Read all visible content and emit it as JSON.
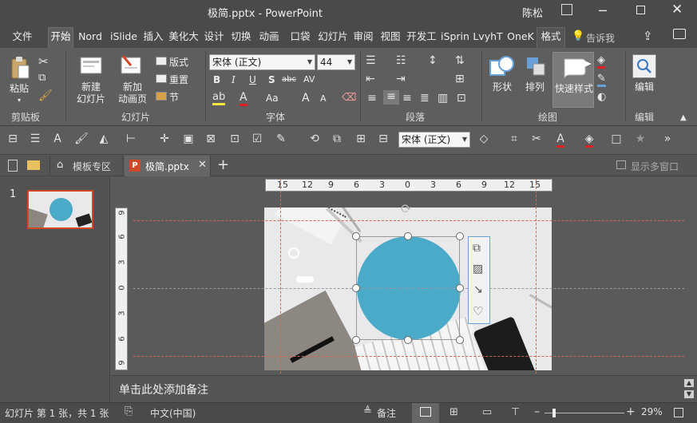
{
  "window": {
    "title": "极简.pptx  -  PowerPoint",
    "user": "陈松"
  },
  "tabs": [
    "文件",
    "开始",
    "Nord",
    "iSlide",
    "插入",
    "美化大",
    "设计",
    "切换",
    "动画",
    "口袋",
    "幻灯片",
    "审阅",
    "视图",
    "开发工",
    "iSprin",
    "LvyhT",
    "OneK",
    "格式"
  ],
  "tell_me": "告诉我",
  "ribbon": {
    "clipboard": {
      "label": "剪贴板",
      "paste": "粘贴"
    },
    "slides": {
      "label": "幻灯片",
      "new_slide_l1": "新建",
      "new_slide_l2": "幻灯片",
      "new_anim_l1": "新加",
      "new_anim_l2": "动画页",
      "layout": "版式",
      "reset": "重置",
      "section": "节"
    },
    "font": {
      "label": "字体",
      "font_name": "宋体 (正文)",
      "font_size": "44",
      "bold": "B",
      "italic": "I",
      "underline": "U",
      "shadow": "S",
      "strike": "abc",
      "spacing": "AV",
      "case": "Aa",
      "grow": "A",
      "shrink": "A"
    },
    "paragraph": {
      "label": "段落"
    },
    "drawing": {
      "label": "绘图",
      "shapes": "形状",
      "arrange": "排列",
      "quick_styles": "快速样式"
    },
    "editing": {
      "label": "编辑",
      "edit": "编辑"
    }
  },
  "qat": {
    "font_name": "宋体 (正文)"
  },
  "doc_tabs": {
    "template": "模板专区",
    "file": "极简.pptx",
    "multi_window": "显示多窗口"
  },
  "thumbnails": [
    {
      "number": "1"
    }
  ],
  "ruler": {
    "h_ticks": [
      "15",
      "12",
      "9",
      "6",
      "3",
      "0",
      "3",
      "6",
      "9",
      "12",
      "15"
    ],
    "v_ticks": [
      "9",
      "6",
      "3",
      "0",
      "3",
      "6",
      "9"
    ]
  },
  "notes_placeholder": "单击此处添加备注",
  "status": {
    "slide_info": "幻灯片 第 1 张，共 1 张",
    "language": "中文(中国)",
    "notes": "备注",
    "zoom": "29%"
  },
  "colors": {
    "circle": "#4aaac8",
    "accent_red": "#d24726",
    "guide": "#d06a4a"
  }
}
